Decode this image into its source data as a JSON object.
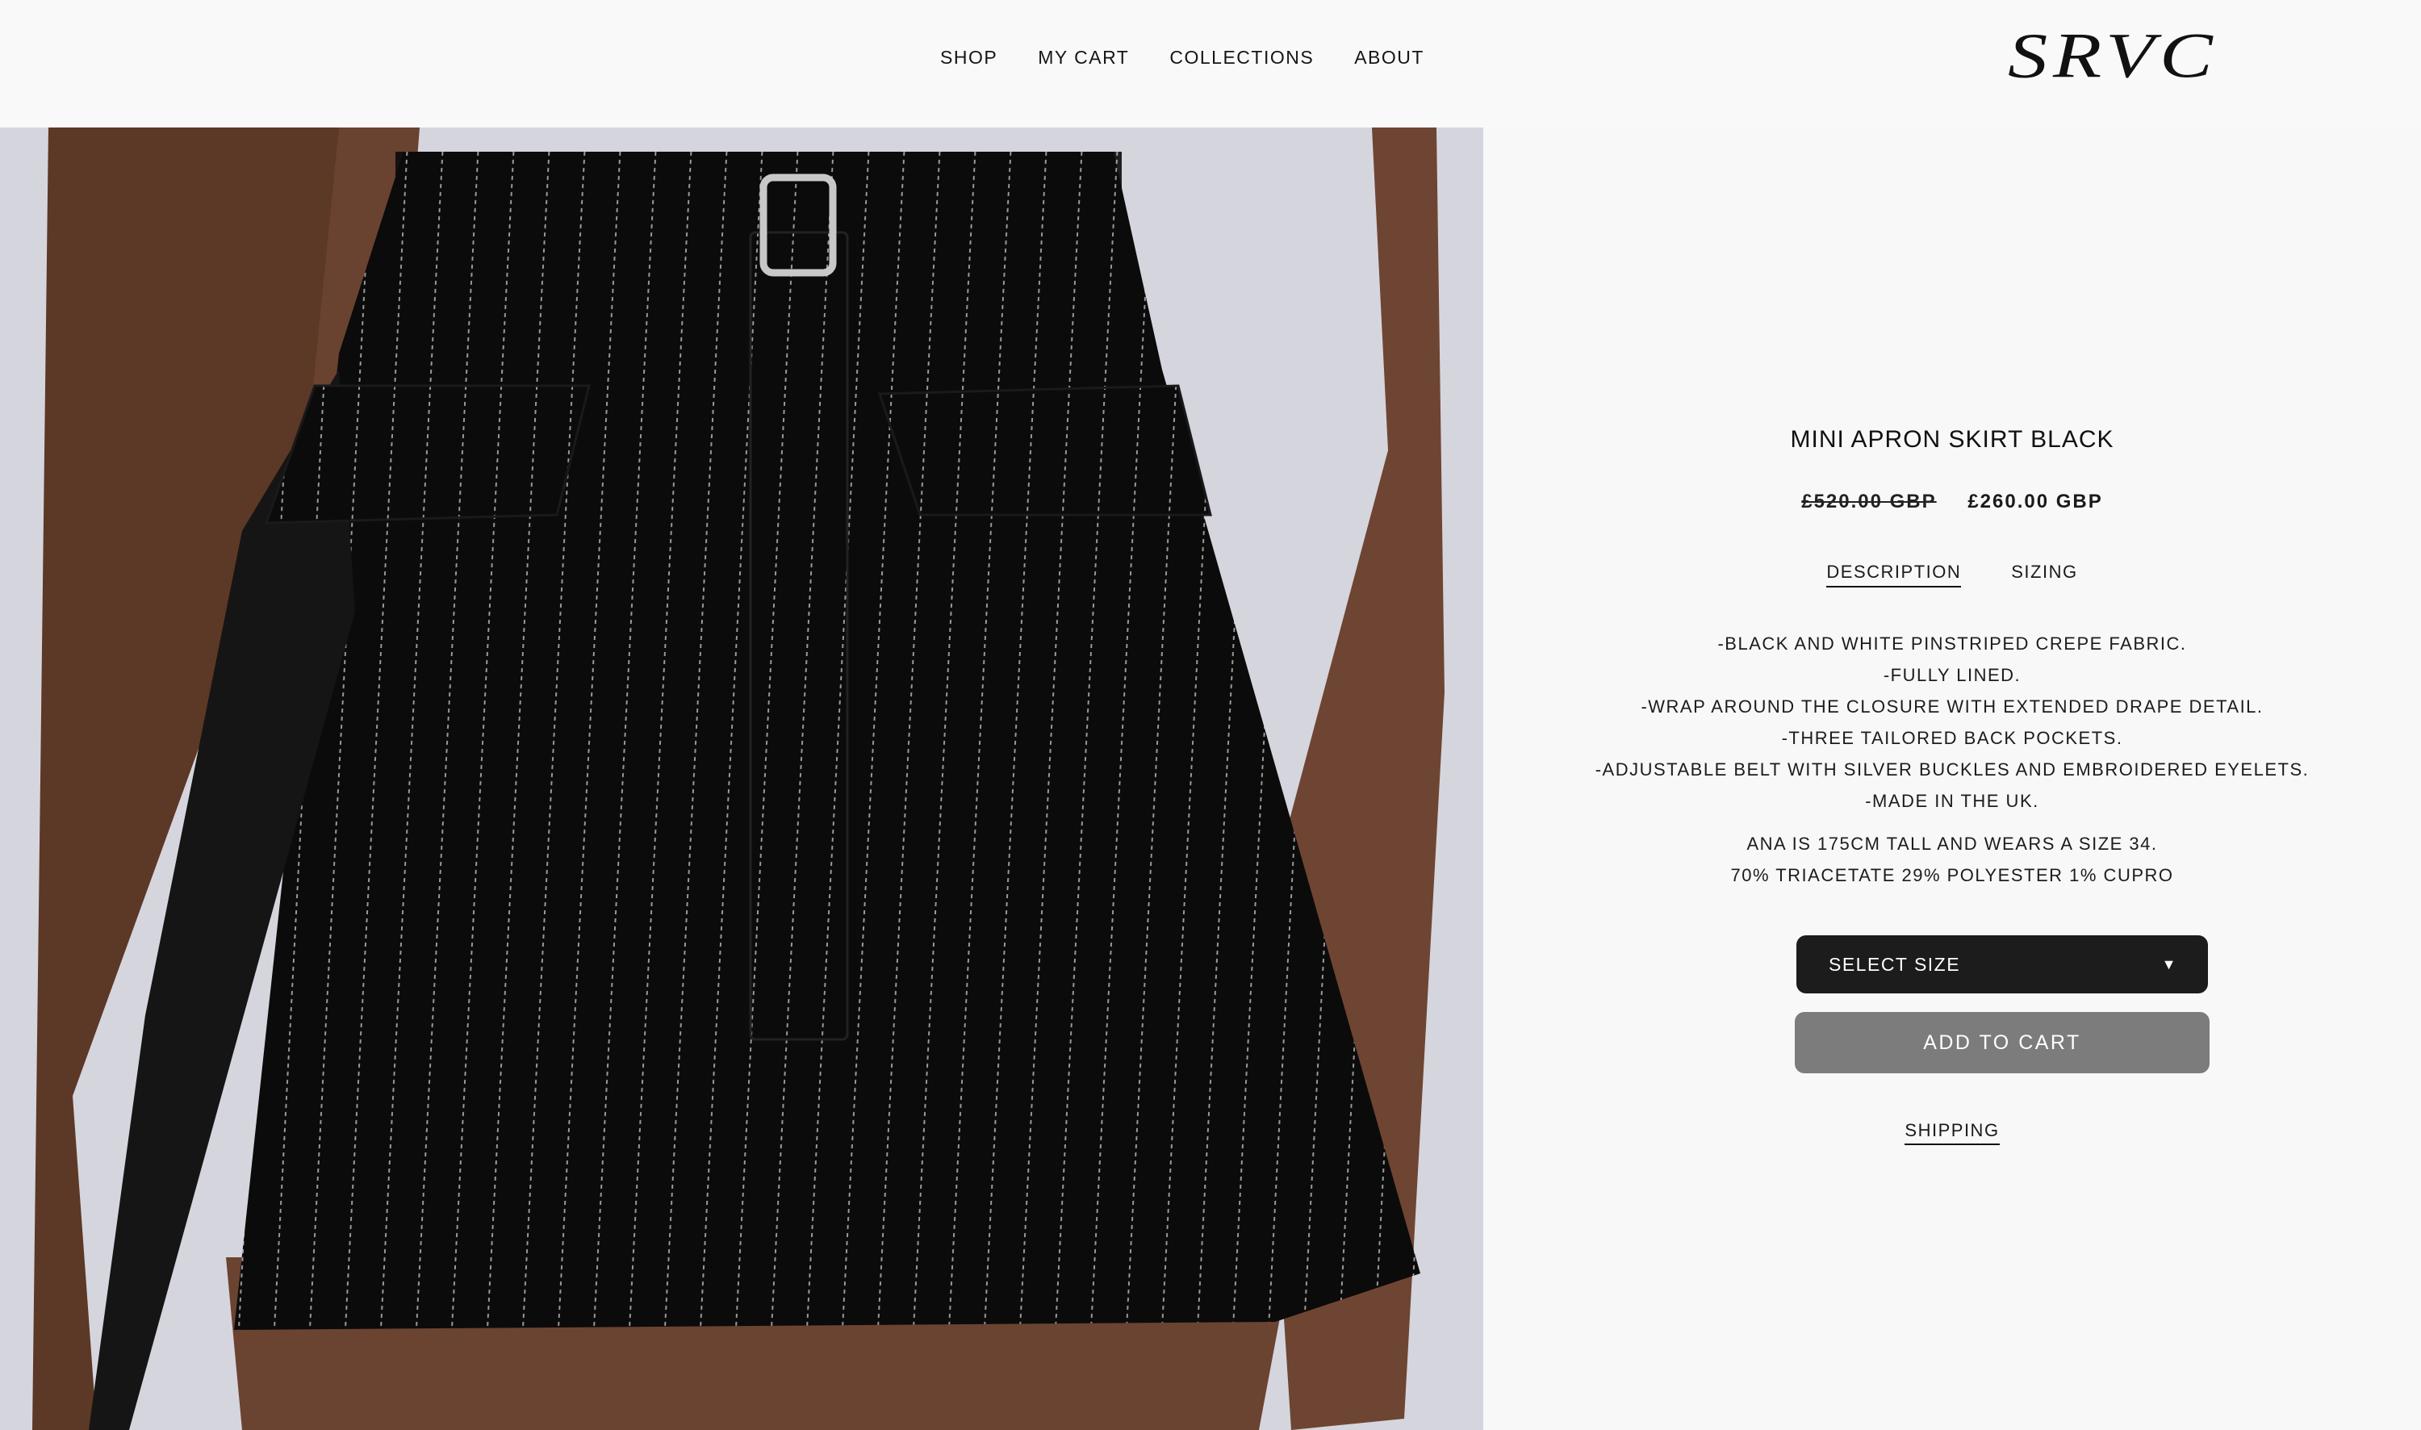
{
  "nav": {
    "items": [
      "SHOP",
      "MY CART",
      "COLLECTIONS",
      "ABOUT"
    ]
  },
  "brand": {
    "logo_text": "SRVC"
  },
  "product": {
    "title": "MINI APRON SKIRT BLACK",
    "price_original": "£520.00 GBP",
    "price_sale": "£260.00 GBP",
    "tabs": [
      "DESCRIPTION",
      "SIZING"
    ],
    "description": [
      "-BLACK AND WHITE PINSTRIPED CREPE FABRIC.",
      "-FULLY LINED.",
      "-WRAP AROUND THE CLOSURE WITH EXTENDED DRAPE DETAIL.",
      "-THREE TAILORED BACK POCKETS.",
      "-ADJUSTABLE BELT WITH SILVER BUCKLES AND EMBROIDERED EYELETS.",
      "-MADE IN THE UK."
    ],
    "model_info": "ANA IS 175CM TALL AND WEARS A SIZE 34.",
    "composition": "70% TRIACETATE 29% POLYESTER 1% CUPRO",
    "select_size_label": "SELECT SIZE",
    "add_to_cart_label": "ADD TO CART",
    "shipping_label": "SHIPPING"
  },
  "colors": {
    "background": "#f8f8f8",
    "select_bg": "#1c1c1c",
    "add_to_cart_bg": "#7c7c7c"
  }
}
